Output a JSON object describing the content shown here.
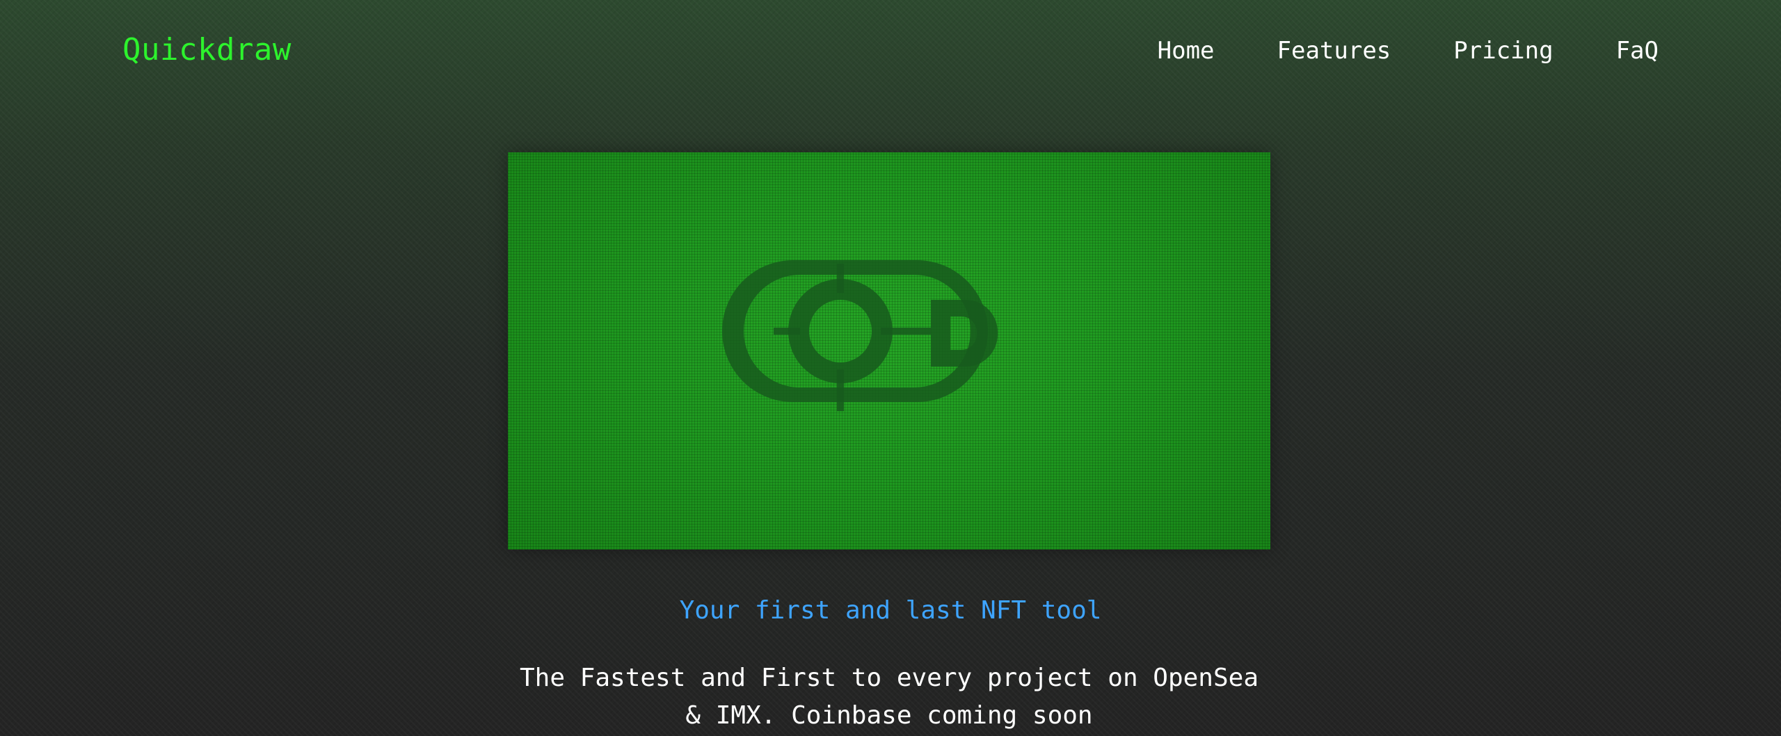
{
  "brand": {
    "name": "Quickdraw",
    "color": "#2df32d"
  },
  "nav": {
    "items": [
      {
        "label": "Home"
      },
      {
        "label": "Features"
      },
      {
        "label": "Pricing"
      },
      {
        "label": "FaQ"
      }
    ]
  },
  "hero": {
    "logo_icon": "quickdraw-qd-crosshair-logo",
    "banner_color": "#1f9a20",
    "tagline": "Your first and last NFT tool",
    "tagline_color": "#3ea4ff",
    "description_line_1": "The Fastest and First to every project on OpenSea",
    "description_line_2": "& IMX. Coinbase coming soon"
  }
}
